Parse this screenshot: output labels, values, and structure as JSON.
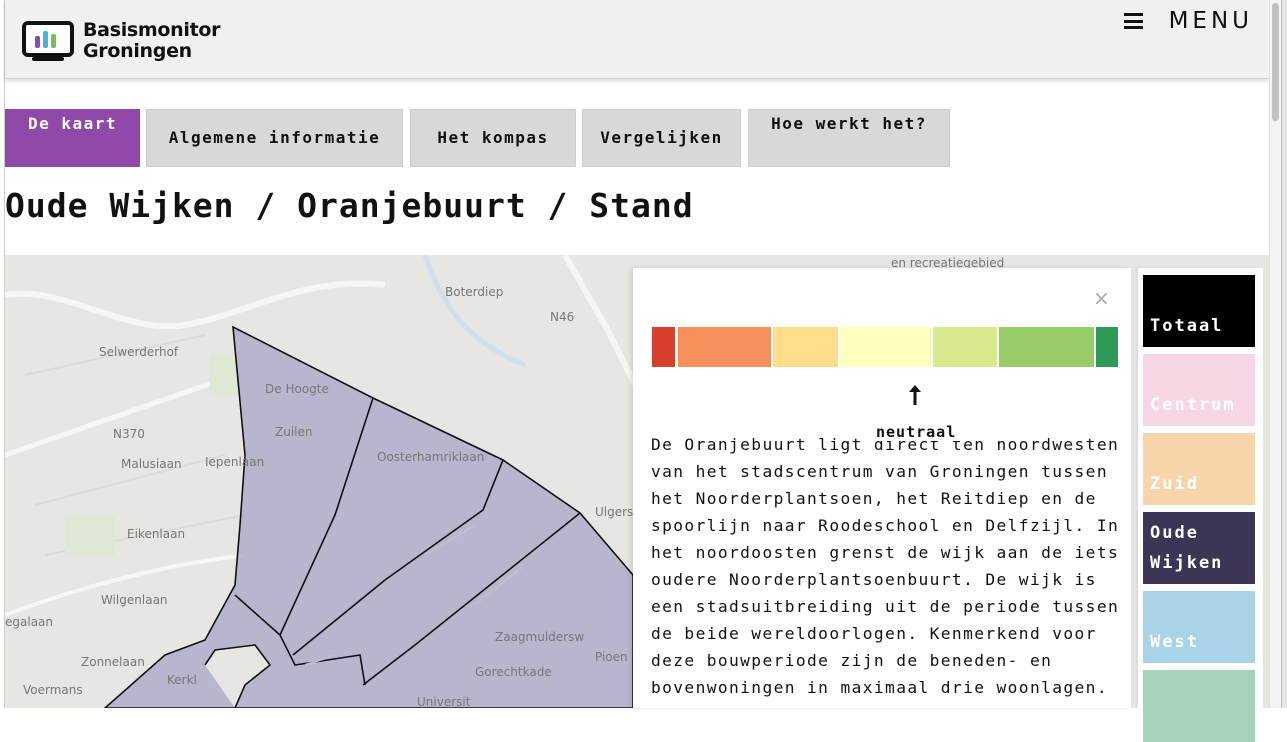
{
  "header": {
    "logo_line1": "Basismonitor",
    "logo_line2": "Groningen",
    "menu_label": "MENU"
  },
  "tabs": [
    {
      "label": "De kaart",
      "active": true
    },
    {
      "label": "Algemene informatie",
      "active": false
    },
    {
      "label": "Het kompas",
      "active": false
    },
    {
      "label": "Vergelijken",
      "active": false
    },
    {
      "label": "Hoe werkt het?",
      "active": false
    }
  ],
  "page_title": "Oude Wijken / Oranjebuurt / Stand",
  "map": {
    "labels": [
      "en recreatiegebied",
      "Selwerderhof",
      "De Hoogte",
      "Zuilen",
      "N370",
      "Malusiaan",
      "Iepenlaan",
      "Oosterhamriklaan",
      "Eikenlaan",
      "Wilgenlaan",
      "egalaan",
      "Voermans",
      "Zonnelaan",
      "Kerkl",
      "Universit",
      "Zaagmuldersw",
      "Gorechtkade",
      "Pioen",
      "N46",
      "Boterdiep",
      "Ulgersm"
    ]
  },
  "panel": {
    "close_symbol": "×",
    "scale_colors": [
      "#d6402d",
      "#f5905c",
      "#fedd8b",
      "#ffffbf",
      "#d9ea8e",
      "#98cc68",
      "#2d9a56"
    ],
    "indicator_label": "neutraal",
    "description": "De Oranjebuurt ligt direct ten noordwesten van het stadscentrum van Groningen tussen het Noorderplantsoen, het Reitdiep en de spoorlijn naar Roodeschool en Delfzijl. In het noordoosten grenst de wijk aan de iets oudere Noorderplantsoenbuurt. De wijk is een stadsuitbreiding uit de periode tussen de beide wereldoorlogen. Kenmerkend voor deze bouwperiode zijn de beneden- en bovenwoningen in maximaal drie woonlagen."
  },
  "categories": [
    {
      "label": "Totaal",
      "color": "#000000"
    },
    {
      "label": "Centrum",
      "color": "#f7d7e5"
    },
    {
      "label": "Zuid",
      "color": "#f8d4aa"
    },
    {
      "label": "Oude Wijken",
      "color": "#3c3555"
    },
    {
      "label": "West",
      "color": "#a9d4e8"
    },
    {
      "label": "",
      "color": "#a8d3b9"
    }
  ]
}
